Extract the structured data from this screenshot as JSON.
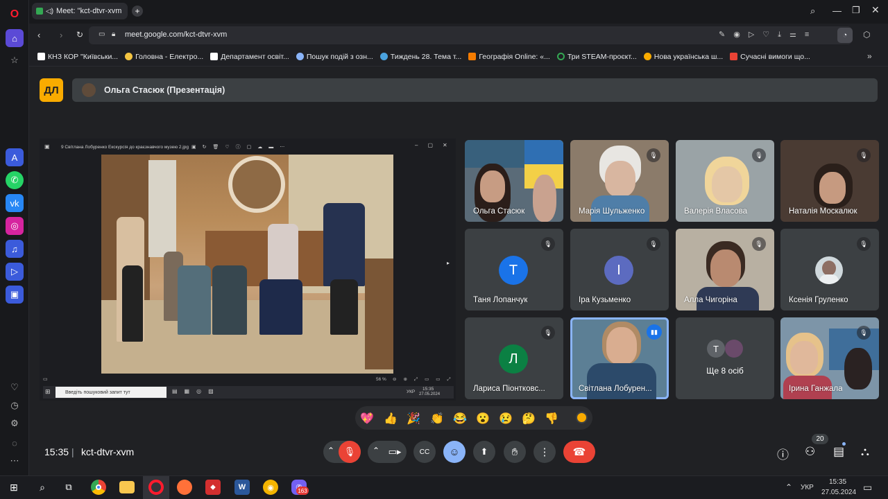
{
  "browser": {
    "tab_title": "Meet: \"kct-dtvr-xvm",
    "url": "meet.google.com/kct-dtvr-xvm",
    "bookmarks": [
      {
        "label": "КНЗ КОР \"Київськи...",
        "color": "#ffffff"
      },
      {
        "label": "Головна - Електро...",
        "color": "#f4c542"
      },
      {
        "label": "Департамент освіт...",
        "color": "#ffffff"
      },
      {
        "label": "Пошук подій з озн...",
        "color": "#8ab4f8"
      },
      {
        "label": "Тиждень 28. Тема т...",
        "color": "#4aa3df"
      },
      {
        "label": "Географія Online: «...",
        "color": "#f57c00"
      },
      {
        "label": "Три STEAM-проєкт...",
        "color": "#34a853"
      },
      {
        "label": "Нова українська ш...",
        "color": "#f9ab00"
      },
      {
        "label": "Сучасні вимоги що...",
        "color": "#ea4335"
      }
    ]
  },
  "meet": {
    "logo_text": "ДЛ",
    "presenter_label": "Ольга Стасюк (Презентація)",
    "presentation": {
      "window_title": "9 Світлана Лобуренко Екскурсія до краєзнавчого музею 2.jpg",
      "zoom": "56 %",
      "search_placeholder": "Введіть пошуковий запит тут",
      "tray_lang": "УКР",
      "tray_time": "15:35",
      "tray_date": "27.05.2024"
    },
    "participants": [
      {
        "name": "Ольга Стасюк",
        "type": "video",
        "muted": false,
        "bg": "#5a6b78",
        "face": "#c79c83"
      },
      {
        "name": "Марія Шульженко",
        "type": "video",
        "muted": true,
        "bg": "#8b7b6a",
        "face": "#d8b6a0"
      },
      {
        "name": "Валерія Власова",
        "type": "video",
        "muted": true,
        "bg": "#9aa3a6",
        "face": "#e4c7a6"
      },
      {
        "name": "Наталія Москалюк",
        "type": "video",
        "muted": true,
        "bg": "#4a3b33",
        "face": "#c69a80"
      },
      {
        "name": "Таня Лопанчук",
        "type": "letter",
        "letter": "T",
        "color": "#1a73e8",
        "muted": true
      },
      {
        "name": "Іра Кузьменко",
        "type": "letter",
        "letter": "I",
        "color": "#5c6bc0",
        "muted": true
      },
      {
        "name": "Алла Чигоріна",
        "type": "video",
        "muted": true,
        "bg": "#b8b0a2",
        "face": "#b98a70"
      },
      {
        "name": "Ксенія Груленко",
        "type": "photo",
        "muted": true
      },
      {
        "name": "Лариса Піонтковс...",
        "type": "letter",
        "letter": "Л",
        "color": "#0b8043",
        "muted": true
      },
      {
        "name": "Світлана Лобурен...",
        "type": "video",
        "muted": false,
        "speaking": true,
        "bg": "#5c7f95",
        "face": "#d9ad90"
      },
      {
        "name": "Ще 8 осіб",
        "type": "more",
        "letter": "T"
      },
      {
        "name": "Ірина Ганжала",
        "type": "video",
        "muted": true,
        "bg": "#7d95a8",
        "face": "#e0b89b"
      }
    ],
    "reactions": [
      "💖",
      "👍",
      "🎉",
      "👏",
      "😂",
      "😮",
      "😢",
      "🤔",
      "👎"
    ],
    "time": "15:35",
    "meeting_code": "kct-dtvr-xvm",
    "people_count": "20",
    "colors": {
      "end_call": "#ea4335",
      "mic_off": "#ea4335",
      "reactions_active": "#8ab4f8",
      "accent_yellow": "#f9ab00"
    }
  },
  "taskbar": {
    "lang": "УКР",
    "time": "15:35",
    "date": "27.05.2024",
    "viber_badge": "163"
  }
}
